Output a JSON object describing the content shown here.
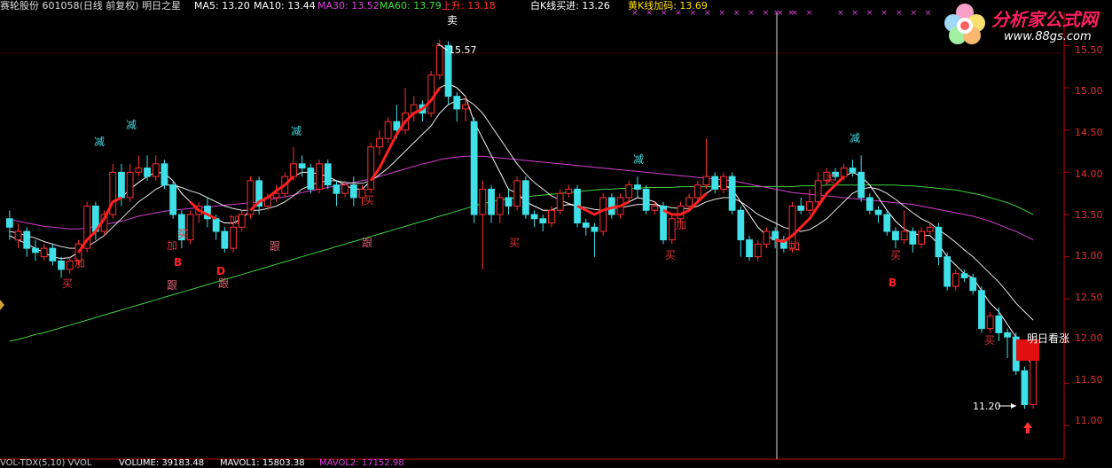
{
  "header": {
    "stock": "赛轮股份 601058(日线 前复权) 明日之星",
    "ma5": "MA5: 13.20",
    "ma10": "MA10: 13.44",
    "ma30": "MA30: 13.52",
    "ma60": "MA60: 13.79",
    "up": "上升: 13.18",
    "white_k": "白K线买进: 13.26",
    "yellow_k": "黄K线加码: 13.69",
    "colors": {
      "stock": "#e0e0e0",
      "ma5": "#ffffff",
      "ma10": "#ffffff",
      "ma30": "#e040e0",
      "ma60": "#40e040",
      "up": "#ff3030",
      "white_k": "#ffffff",
      "yellow_k": "#ffe000"
    }
  },
  "x_marks": [
    "× × × × × × × × × × × × ×",
    "× ×",
    "× × × ×",
    "× × ×"
  ],
  "logo": {
    "title": "分析家公式网",
    "url": "www.88gs.com"
  },
  "price_axis": {
    "labels": [
      "15.50",
      "15.00",
      "14.50",
      "14.00",
      "13.50",
      "13.00",
      "12.50",
      "12.00",
      "11.50",
      "11.00"
    ],
    "ylim": [
      10.95,
      15.62
    ]
  },
  "annotations": {
    "high": "15.57",
    "low": "11.20",
    "tomorrow": "明日看涨",
    "sell_top": "卖"
  },
  "signals": {
    "jian": "减",
    "jia": "加",
    "mai": "买",
    "gen": "跟",
    "b": "B",
    "d": "D"
  },
  "bottom": {
    "text": "VOL-TDX(5,10) VVOL",
    "volume": "VOLUME: 39183.48",
    "mavol1": "MAVOL1: 15803.38",
    "mavol2": "MAVOL2: 17152.98"
  },
  "chart_data": {
    "type": "candlestick",
    "ylim": [
      10.95,
      15.62
    ],
    "candles": [
      [
        13.45,
        13.35,
        13.55,
        13.2
      ],
      [
        13.2,
        13.3,
        13.4,
        13.1
      ],
      [
        13.3,
        13.1,
        13.35,
        13.0
      ],
      [
        13.1,
        13.05,
        13.2,
        12.95
      ],
      [
        13.0,
        13.1,
        13.15,
        12.95
      ],
      [
        13.1,
        12.95,
        13.15,
        12.9
      ],
      [
        12.95,
        12.85,
        13.0,
        12.75
      ],
      [
        12.85,
        12.95,
        13.0,
        12.8
      ],
      [
        12.95,
        13.15,
        13.2,
        12.9
      ],
      [
        13.1,
        13.6,
        13.65,
        13.05
      ],
      [
        13.6,
        13.3,
        13.65,
        13.2
      ],
      [
        13.3,
        13.5,
        13.55,
        13.25
      ],
      [
        13.5,
        14.0,
        14.1,
        13.45
      ],
      [
        14.0,
        13.7,
        14.1,
        13.6
      ],
      [
        13.7,
        14.0,
        14.1,
        13.65
      ],
      [
        14.0,
        14.05,
        14.2,
        13.95
      ],
      [
        14.05,
        13.95,
        14.2,
        13.9
      ],
      [
        13.95,
        14.1,
        14.2,
        13.9
      ],
      [
        14.1,
        13.85,
        14.15,
        13.8
      ],
      [
        13.85,
        13.5,
        13.9,
        13.45
      ],
      [
        13.5,
        13.2,
        13.55,
        13.1
      ],
      [
        13.2,
        13.5,
        13.55,
        13.15
      ],
      [
        13.5,
        13.6,
        13.65,
        13.4
      ],
      [
        13.6,
        13.45,
        13.7,
        13.35
      ],
      [
        13.45,
        13.3,
        13.5,
        13.2
      ],
      [
        13.3,
        13.1,
        13.35,
        13.05
      ],
      [
        13.1,
        13.35,
        13.4,
        13.05
      ],
      [
        13.35,
        13.5,
        13.55,
        13.3
      ],
      [
        13.5,
        13.9,
        13.95,
        13.45
      ],
      [
        13.9,
        13.6,
        13.95,
        13.5
      ],
      [
        13.6,
        13.7,
        13.75,
        13.55
      ],
      [
        13.7,
        13.75,
        13.85,
        13.65
      ],
      [
        13.75,
        13.95,
        14.0,
        13.7
      ],
      [
        13.95,
        14.1,
        14.3,
        13.9
      ],
      [
        14.1,
        14.05,
        14.2,
        13.95
      ],
      [
        14.05,
        13.8,
        14.1,
        13.75
      ],
      [
        13.8,
        14.1,
        14.15,
        13.75
      ],
      [
        14.1,
        13.85,
        14.15,
        13.8
      ],
      [
        13.85,
        13.75,
        13.9,
        13.6
      ],
      [
        13.75,
        13.85,
        13.9,
        13.7
      ],
      [
        13.85,
        13.7,
        13.95,
        13.6
      ],
      [
        13.7,
        13.8,
        13.85,
        13.6
      ],
      [
        13.8,
        14.3,
        14.35,
        13.75
      ],
      [
        14.3,
        14.4,
        14.5,
        14.2
      ],
      [
        14.4,
        14.6,
        14.65,
        14.35
      ],
      [
        14.6,
        14.5,
        14.8,
        14.4
      ],
      [
        14.5,
        14.7,
        15.0,
        14.45
      ],
      [
        14.7,
        14.8,
        14.9,
        14.6
      ],
      [
        14.8,
        14.7,
        14.85,
        14.6
      ],
      [
        14.7,
        15.15,
        15.2,
        14.65
      ],
      [
        15.15,
        15.5,
        15.57,
        15.1
      ],
      [
        15.5,
        14.9,
        15.55,
        14.8
      ],
      [
        14.9,
        14.75,
        14.95,
        14.6
      ],
      [
        14.75,
        14.8,
        14.9,
        14.6
      ],
      [
        14.6,
        13.5,
        14.65,
        13.4
      ],
      [
        13.5,
        13.8,
        13.9,
        12.85
      ],
      [
        13.8,
        13.5,
        13.85,
        13.4
      ],
      [
        13.5,
        13.7,
        13.75,
        13.4
      ],
      [
        13.7,
        13.6,
        13.8,
        13.5
      ],
      [
        13.6,
        13.9,
        13.95,
        13.55
      ],
      [
        13.9,
        13.5,
        13.95,
        13.45
      ],
      [
        13.5,
        13.45,
        13.55,
        13.35
      ],
      [
        13.45,
        13.4,
        13.5,
        13.3
      ],
      [
        13.4,
        13.55,
        13.6,
        13.35
      ],
      [
        13.55,
        13.75,
        13.8,
        13.5
      ],
      [
        13.75,
        13.8,
        13.85,
        13.7
      ],
      [
        13.8,
        13.4,
        13.85,
        13.35
      ],
      [
        13.4,
        13.35,
        13.45,
        13.25
      ],
      [
        13.35,
        13.3,
        13.4,
        13.0
      ],
      [
        13.3,
        13.7,
        13.75,
        13.25
      ],
      [
        13.7,
        13.5,
        13.75,
        13.45
      ],
      [
        13.5,
        13.7,
        13.75,
        13.45
      ],
      [
        13.7,
        13.85,
        13.9,
        13.65
      ],
      [
        13.85,
        13.8,
        13.95,
        13.7
      ],
      [
        13.8,
        13.55,
        13.85,
        13.5
      ],
      [
        13.55,
        13.6,
        13.65,
        13.5
      ],
      [
        13.6,
        13.2,
        13.65,
        13.15
      ],
      [
        13.2,
        13.45,
        13.5,
        13.15
      ],
      [
        13.45,
        13.6,
        13.65,
        13.4
      ],
      [
        13.6,
        13.7,
        13.75,
        13.55
      ],
      [
        13.7,
        13.85,
        13.9,
        13.65
      ],
      [
        13.85,
        13.95,
        14.4,
        13.8
      ],
      [
        13.95,
        13.8,
        14.0,
        13.75
      ],
      [
        13.8,
        13.95,
        14.0,
        13.75
      ],
      [
        13.95,
        13.55,
        14.0,
        13.5
      ],
      [
        13.55,
        13.2,
        13.6,
        13.0
      ],
      [
        13.2,
        13.0,
        13.25,
        12.95
      ],
      [
        13.0,
        13.15,
        13.2,
        12.95
      ],
      [
        13.15,
        13.3,
        13.35,
        13.1
      ],
      [
        13.3,
        13.2,
        13.35,
        13.1
      ],
      [
        13.2,
        13.1,
        13.25,
        13.05
      ],
      [
        13.1,
        13.6,
        13.65,
        13.05
      ],
      [
        13.6,
        13.55,
        13.7,
        13.5
      ],
      [
        13.55,
        13.65,
        13.8,
        13.5
      ],
      [
        13.65,
        13.9,
        14.0,
        13.6
      ],
      [
        13.9,
        14.0,
        14.05,
        13.85
      ],
      [
        14.0,
        13.95,
        14.05,
        13.9
      ],
      [
        13.95,
        14.05,
        14.1,
        13.9
      ],
      [
        14.05,
        14.0,
        14.15,
        13.95
      ],
      [
        14.0,
        13.7,
        14.2,
        13.65
      ],
      [
        13.7,
        13.55,
        13.75,
        13.5
      ],
      [
        13.55,
        13.5,
        13.6,
        13.4
      ],
      [
        13.5,
        13.3,
        13.55,
        13.25
      ],
      [
        13.3,
        13.2,
        13.35,
        13.1
      ],
      [
        13.2,
        13.3,
        13.55,
        13.15
      ],
      [
        13.3,
        13.15,
        13.35,
        13.05
      ],
      [
        13.15,
        13.3,
        13.35,
        13.1
      ],
      [
        13.3,
        13.35,
        13.4,
        13.25
      ],
      [
        13.35,
        13.0,
        13.4,
        12.9
      ],
      [
        13.0,
        12.65,
        13.05,
        12.6
      ],
      [
        12.65,
        12.8,
        12.85,
        12.6
      ],
      [
        12.8,
        12.75,
        12.85,
        12.7
      ],
      [
        12.75,
        12.6,
        12.8,
        12.55
      ],
      [
        12.6,
        12.15,
        12.65,
        12.1
      ],
      [
        12.15,
        12.3,
        12.35,
        12.1
      ],
      [
        12.3,
        12.1,
        12.4,
        12.0
      ],
      [
        12.1,
        12.05,
        12.15,
        11.8
      ],
      [
        12.05,
        11.65,
        12.1,
        11.6
      ],
      [
        11.65,
        11.25,
        11.7,
        11.2
      ],
      [
        11.25,
        11.95,
        12.05,
        11.2
      ]
    ],
    "ma5": [
      13.25,
      13.2,
      13.15,
      13.1,
      13.05,
      13.0,
      12.98,
      12.99,
      13.05,
      13.2,
      13.3,
      13.45,
      13.65,
      13.7,
      13.8,
      13.88,
      13.95,
      14.0,
      13.99,
      13.9,
      13.75,
      13.65,
      13.55,
      13.5,
      13.45,
      13.4,
      13.4,
      13.45,
      13.55,
      13.65,
      13.7,
      13.78,
      13.85,
      13.95,
      14.0,
      14.0,
      13.98,
      13.95,
      13.9,
      13.85,
      13.8,
      13.8,
      13.9,
      14.05,
      14.25,
      14.45,
      14.6,
      14.7,
      14.75,
      14.85,
      15.0,
      15.05,
      15.0,
      14.9,
      14.6,
      14.4,
      14.2,
      14.0,
      13.8,
      13.75,
      13.65,
      13.6,
      13.55,
      13.55,
      13.6,
      13.62,
      13.6,
      13.55,
      13.5,
      13.55,
      13.58,
      13.6,
      13.65,
      13.7,
      13.68,
      13.65,
      13.55,
      13.5,
      13.5,
      13.55,
      13.65,
      13.75,
      13.82,
      13.85,
      13.8,
      13.65,
      13.5,
      13.35,
      13.25,
      13.2,
      13.18,
      13.25,
      13.35,
      13.45,
      13.6,
      13.75,
      13.85,
      13.95,
      14.0,
      13.95,
      13.85,
      13.7,
      13.55,
      13.42,
      13.33,
      13.28,
      13.25,
      13.25,
      13.15,
      13.0,
      12.9,
      12.8,
      12.75,
      12.6,
      12.45,
      12.35,
      12.2,
      12.05,
      11.85,
      11.7
    ],
    "ma10": [
      13.3,
      13.28,
      13.25,
      13.22,
      13.18,
      13.15,
      13.12,
      13.1,
      13.1,
      13.12,
      13.18,
      13.25,
      13.35,
      13.45,
      13.55,
      13.65,
      13.72,
      13.8,
      13.85,
      13.85,
      13.82,
      13.78,
      13.75,
      13.7,
      13.65,
      13.6,
      13.57,
      13.55,
      13.55,
      13.55,
      13.57,
      13.6,
      13.65,
      13.72,
      13.8,
      13.85,
      13.88,
      13.9,
      13.9,
      13.88,
      13.87,
      13.87,
      13.9,
      13.97,
      14.05,
      14.15,
      14.25,
      14.35,
      14.45,
      14.55,
      14.7,
      14.8,
      14.85,
      14.87,
      14.8,
      14.7,
      14.55,
      14.4,
      14.25,
      14.1,
      13.98,
      13.88,
      13.8,
      13.72,
      13.67,
      13.63,
      13.6,
      13.58,
      13.56,
      13.55,
      13.57,
      13.58,
      13.6,
      13.62,
      13.62,
      13.62,
      13.6,
      13.58,
      13.57,
      13.57,
      13.6,
      13.65,
      13.68,
      13.7,
      13.7,
      13.65,
      13.58,
      13.5,
      13.45,
      13.4,
      13.35,
      13.32,
      13.3,
      13.32,
      13.38,
      13.45,
      13.55,
      13.65,
      13.75,
      13.8,
      13.82,
      13.8,
      13.75,
      13.68,
      13.6,
      13.52,
      13.45,
      13.4,
      13.32,
      13.25,
      13.17,
      13.08,
      13.0,
      12.9,
      12.8,
      12.7,
      12.58,
      12.45,
      12.35,
      12.25
    ],
    "ma30": [
      13.45,
      13.42,
      13.4,
      13.38,
      13.36,
      13.35,
      13.34,
      13.33,
      13.33,
      13.34,
      13.36,
      13.38,
      13.4,
      13.42,
      13.45,
      13.48,
      13.5,
      13.52,
      13.54,
      13.55,
      13.56,
      13.57,
      13.58,
      13.59,
      13.6,
      13.61,
      13.62,
      13.63,
      13.64,
      13.65,
      13.67,
      13.69,
      13.71,
      13.73,
      13.76,
      13.78,
      13.8,
      13.82,
      13.84,
      13.86,
      13.88,
      13.9,
      13.92,
      13.95,
      13.98,
      14.01,
      14.04,
      14.07,
      14.1,
      14.12,
      14.15,
      14.17,
      14.18,
      14.19,
      14.19,
      14.19,
      14.18,
      14.17,
      14.16,
      14.15,
      14.14,
      14.13,
      14.12,
      14.11,
      14.1,
      14.09,
      14.08,
      14.07,
      14.06,
      14.05,
      14.04,
      14.03,
      14.02,
      14.01,
      14.0,
      13.99,
      13.98,
      13.97,
      13.96,
      13.95,
      13.94,
      13.93,
      13.92,
      13.91,
      13.9,
      13.88,
      13.86,
      13.84,
      13.82,
      13.8,
      13.78,
      13.76,
      13.75,
      13.74,
      13.73,
      13.72,
      13.71,
      13.7,
      13.69,
      13.68,
      13.67,
      13.66,
      13.65,
      13.64,
      13.63,
      13.62,
      13.6,
      13.58,
      13.56,
      13.54,
      13.52,
      13.5,
      13.48,
      13.45,
      13.42,
      13.38,
      13.34,
      13.3,
      13.25,
      13.2
    ],
    "ma60": [
      12.0,
      12.02,
      12.05,
      12.08,
      12.1,
      12.13,
      12.16,
      12.19,
      12.22,
      12.25,
      12.28,
      12.31,
      12.34,
      12.37,
      12.4,
      12.43,
      12.46,
      12.49,
      12.52,
      12.55,
      12.58,
      12.61,
      12.64,
      12.67,
      12.7,
      12.73,
      12.76,
      12.79,
      12.82,
      12.85,
      12.88,
      12.91,
      12.94,
      12.97,
      13.0,
      13.03,
      13.06,
      13.09,
      13.12,
      13.15,
      13.18,
      13.21,
      13.24,
      13.27,
      13.3,
      13.33,
      13.36,
      13.39,
      13.42,
      13.45,
      13.48,
      13.51,
      13.54,
      13.57,
      13.6,
      13.63,
      13.65,
      13.67,
      13.69,
      13.7,
      13.71,
      13.72,
      13.73,
      13.74,
      13.75,
      13.76,
      13.77,
      13.78,
      13.79,
      13.8,
      13.8,
      13.81,
      13.81,
      13.81,
      13.82,
      13.82,
      13.82,
      13.82,
      13.83,
      13.83,
      13.83,
      13.83,
      13.83,
      13.83,
      13.83,
      13.83,
      13.83,
      13.83,
      13.83,
      13.83,
      13.83,
      13.83,
      13.84,
      13.84,
      13.84,
      13.85,
      13.85,
      13.85,
      13.85,
      13.85,
      13.85,
      13.85,
      13.85,
      13.85,
      13.84,
      13.84,
      13.83,
      13.82,
      13.81,
      13.8,
      13.79,
      13.77,
      13.75,
      13.73,
      13.7,
      13.67,
      13.64,
      13.6,
      13.55,
      13.5
    ]
  }
}
